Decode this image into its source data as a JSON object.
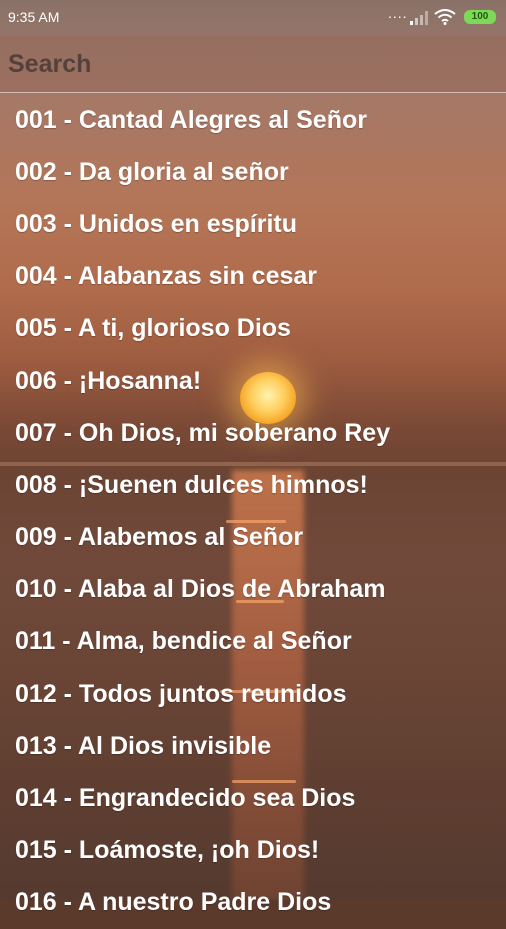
{
  "status_bar": {
    "time": "9:35 AM",
    "signal_dots": "....",
    "battery": "100",
    "icons": [
      "signal-icon",
      "wifi-icon",
      "battery-icon"
    ]
  },
  "search": {
    "placeholder": "Search",
    "value": ""
  },
  "hymns": [
    "001 - Cantad Alegres al Señor",
    "002 - Da gloria al señor",
    "003 - Unidos en espíritu",
    "004 - Alabanzas sin cesar",
    "005 - A ti, glorioso Dios",
    "006 - ¡Hosanna!",
    "007 - Oh Dios, mi soberano Rey",
    "008 - ¡Suenen dulces himnos!",
    "009 - Alabemos al Señor",
    "010 - Alaba al Dios de Abraham",
    "011 - Alma, bendice al Señor",
    "012 - Todos juntos reunidos",
    "013 - Al Dios invisible",
    "014 - Engrandecido sea Dios",
    "015 - Loámoste, ¡oh Dios!",
    "016 - A nuestro Padre Dios"
  ]
}
